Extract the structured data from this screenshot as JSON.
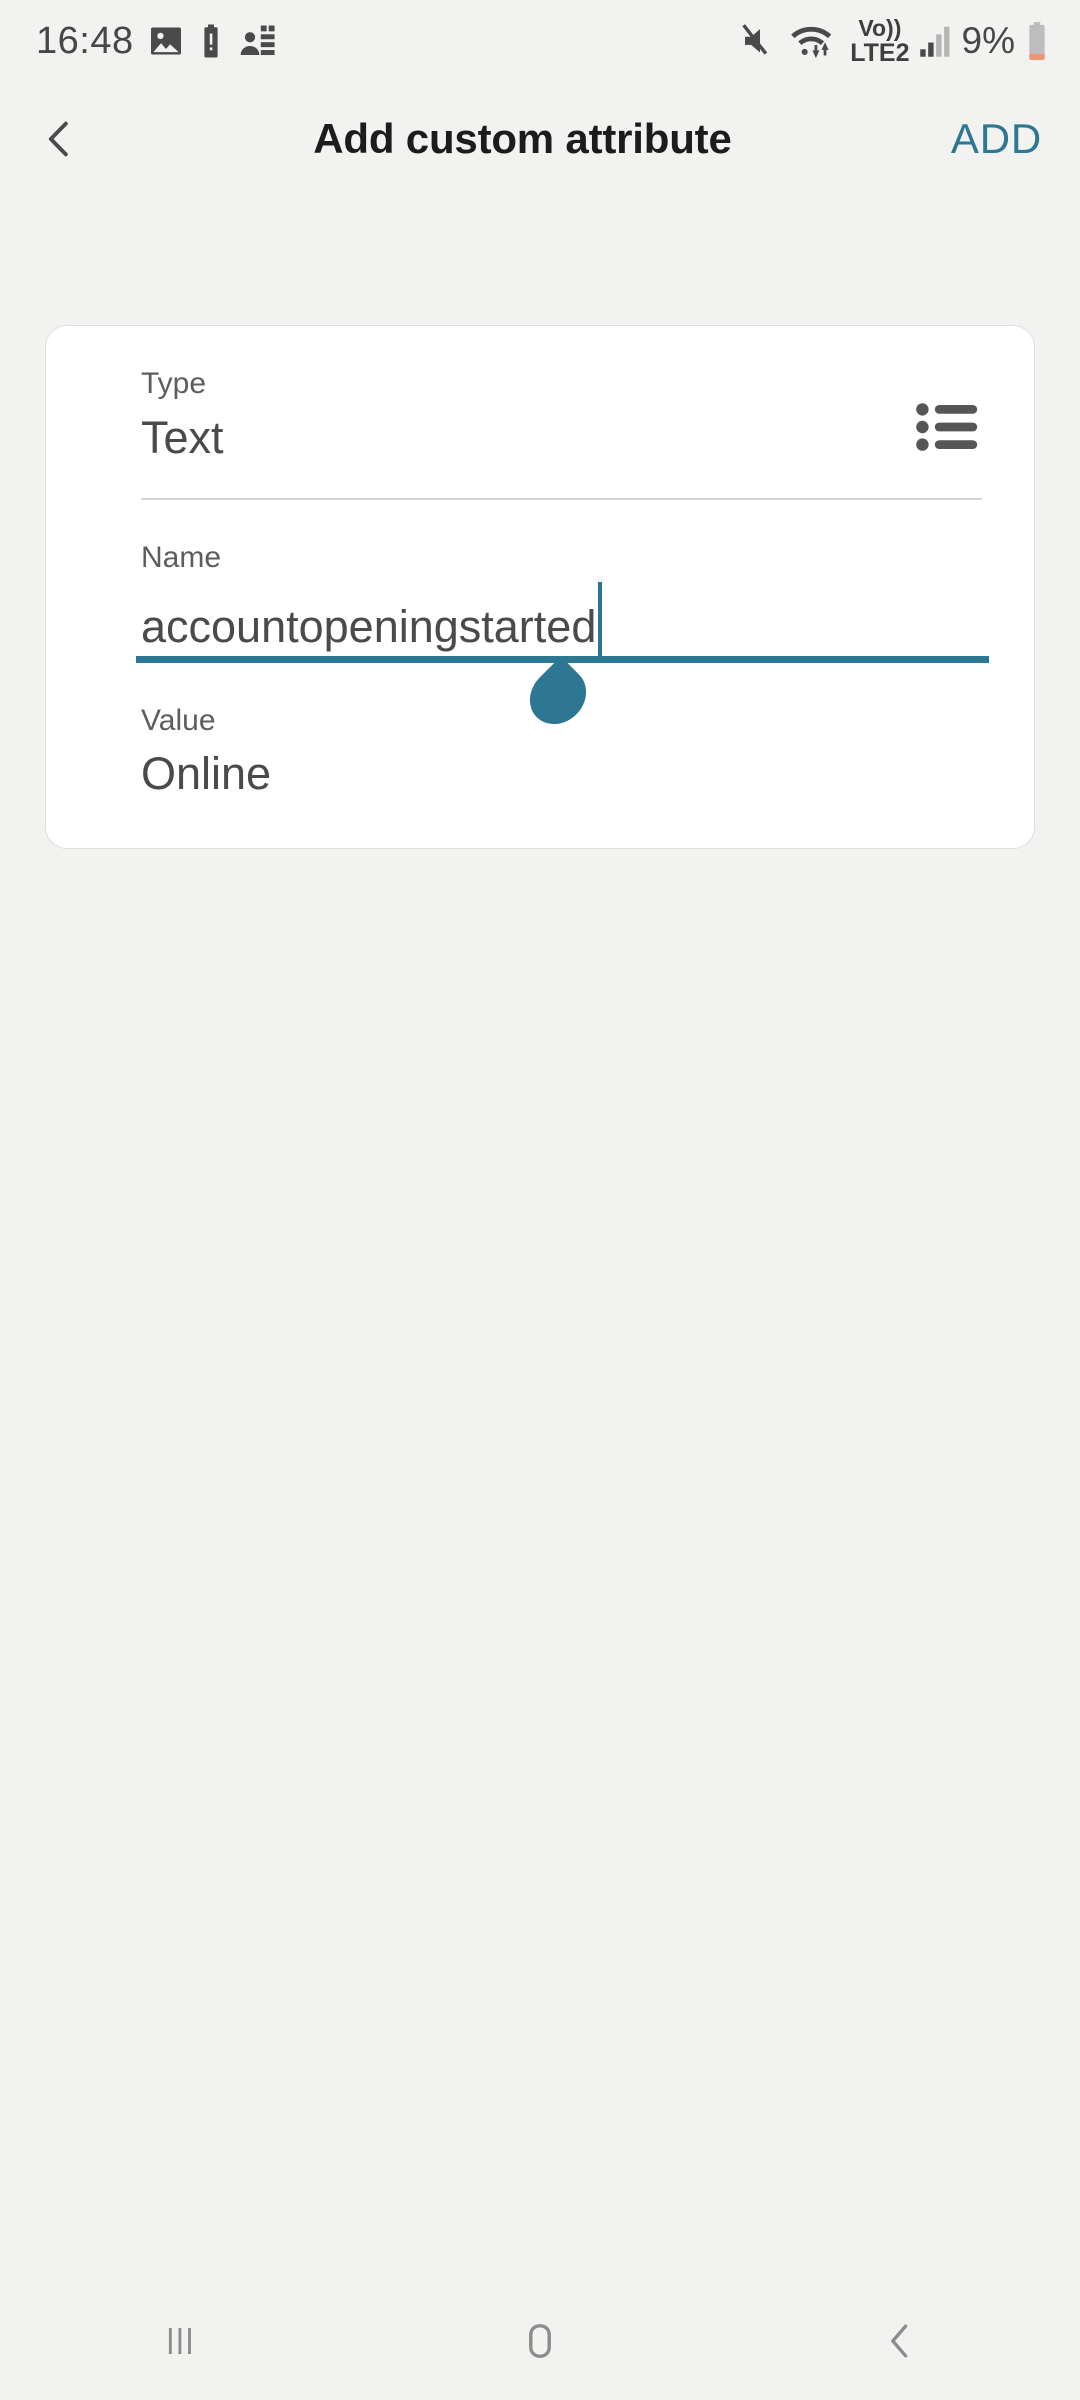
{
  "status_bar": {
    "clock": "16:48",
    "battery_percent": "9%",
    "network_label_top": "Vo))",
    "network_label_bottom": "LTE2",
    "left_icons": [
      "image-icon",
      "battery-alert-icon",
      "contacts-icon"
    ],
    "right_icons": [
      "mute-icon",
      "wifi-data-icon",
      "volte-lte2-icon",
      "signal-bars-icon",
      "battery-low-icon"
    ]
  },
  "header": {
    "back_icon": "chevron-left-icon",
    "title": "Add custom attribute",
    "add_label": "ADD",
    "accent_color": "#2e7793"
  },
  "form": {
    "type": {
      "label": "Type",
      "value": "Text",
      "picker_icon": "bulleted-list-icon"
    },
    "name": {
      "label": "Name",
      "value": "accountopeningstarted",
      "focused": true,
      "underline_color": "#2e7793",
      "handle_icon": "text-selection-handle-icon"
    },
    "value": {
      "label": "Value",
      "value": "Online"
    }
  },
  "nav_bar": {
    "recents_icon": "recents-icon",
    "home_icon": "home-icon",
    "back_icon": "back-chevron-icon"
  }
}
